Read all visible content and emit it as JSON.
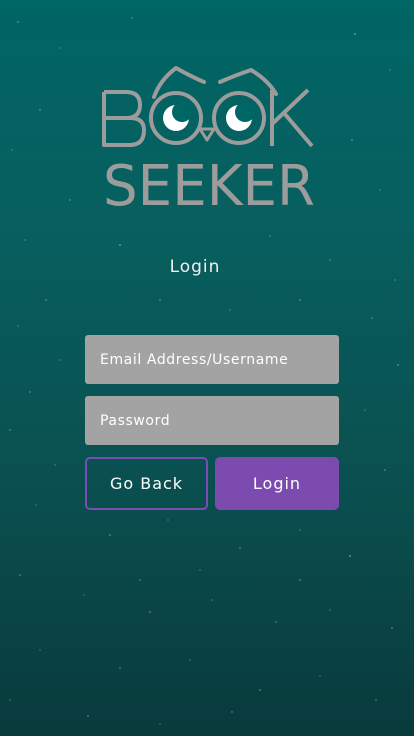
{
  "brand": {
    "logo_line1": "BOOK",
    "logo_line2": "SEEKER"
  },
  "page": {
    "title": "Login"
  },
  "form": {
    "email_placeholder": "Email Address/Username",
    "password_placeholder": "Password"
  },
  "actions": {
    "back_label": "Go Back",
    "login_label": "Login"
  },
  "colors": {
    "background_top": "#006565",
    "background_bottom": "#093a3c",
    "field_background": "#a3a3a3",
    "accent_purple": "#7b4bb0",
    "logo_gray": "#9c9c9c"
  }
}
